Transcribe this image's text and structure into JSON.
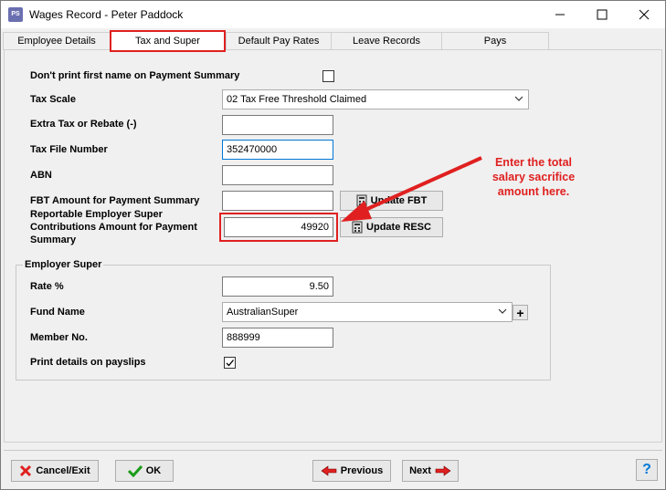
{
  "window": {
    "app_icon_text": "PS",
    "title": "Wages Record - Peter Paddock"
  },
  "tabs": [
    {
      "label": "Employee Details",
      "active": false
    },
    {
      "label": "Tax and Super",
      "active": true
    },
    {
      "label": "Default Pay Rates",
      "active": false
    },
    {
      "label": "Leave Records",
      "active": false
    },
    {
      "label": "Pays",
      "active": false
    }
  ],
  "form": {
    "dont_print_first_name_label": "Don't print first name on Payment Summary",
    "dont_print_first_name_checked": false,
    "tax_scale_label": "Tax Scale",
    "tax_scale_value": "02 Tax Free Threshold Claimed",
    "extra_tax_label": "Extra Tax or Rebate (-)",
    "extra_tax_value": "",
    "tfn_label": "Tax File Number",
    "tfn_value": "352470000",
    "abn_label": "ABN",
    "abn_value": "",
    "fbt_label": "FBT Amount for Payment Summary",
    "fbt_value": "",
    "update_fbt_label": "Update FBT",
    "resc_label_line1": "Reportable Employer Super",
    "resc_label_line2": "Contributions Amount for Payment",
    "resc_label_line3": "Summary",
    "resc_value": "49920",
    "update_resc_label": "Update RESC"
  },
  "employer_super": {
    "group_title": "Employer Super",
    "rate_label": "Rate %",
    "rate_value": "9.50",
    "fund_name_label": "Fund Name",
    "fund_name_value": "AustralianSuper",
    "add_fund_label": "+",
    "member_no_label": "Member No.",
    "member_no_value": "888999",
    "print_details_label": "Print details on payslips",
    "print_details_checked": true
  },
  "annotation": {
    "line1": "Enter the total",
    "line2": "salary sacrifice",
    "line3": "amount here."
  },
  "footer": {
    "cancel_label": "Cancel/Exit",
    "ok_label": "OK",
    "previous_label": "Previous",
    "next_label": "Next",
    "help_label": "?"
  },
  "colors": {
    "accent_red": "#e02020",
    "focus_blue": "#0078d7",
    "ok_green": "#1a9c1a"
  }
}
